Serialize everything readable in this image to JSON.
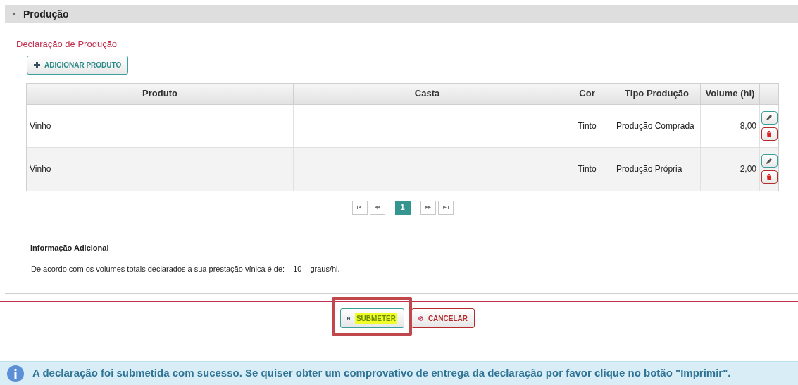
{
  "section": {
    "title": "Produção",
    "expanded": true
  },
  "subtitle": "Declaração de Produção",
  "add_button": "ADICIONAR PRODUTO",
  "table": {
    "columns": [
      "Produto",
      "Casta",
      "Cor",
      "Tipo Produção",
      "Volume (hl)"
    ],
    "rows": [
      {
        "cells": [
          "Vinho",
          "",
          "Tinto",
          "Produção Comprada",
          "8,00"
        ]
      },
      {
        "cells": [
          "Vinho",
          "",
          "Tinto",
          "Produção Própria",
          "2,00"
        ]
      }
    ]
  },
  "pagination": {
    "pages": [
      {
        "label": "1",
        "selected": true
      }
    ]
  },
  "info": {
    "title": "Informação Adicional",
    "text": "De acordo com os volumes totais declarados a sua prestação vínica é de:",
    "value": "10",
    "unit": "graus/hl."
  },
  "actions": [
    {
      "label": "SUBMETER",
      "kind": "submit",
      "highlighted": true
    },
    {
      "label": "CANCELAR",
      "kind": "cancel",
      "highlighted": false
    }
  ],
  "alert": "A declaração foi submetida com sucesso. Se quiser obter um comprovativo de entrega da declaração por favor clique no botão \"Imprimir\"."
}
